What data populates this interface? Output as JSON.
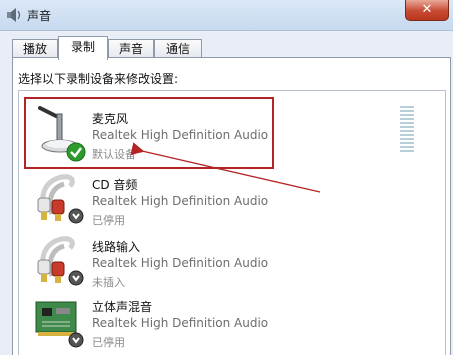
{
  "window": {
    "title": "声音"
  },
  "tabs": [
    {
      "label": "播放",
      "active": false
    },
    {
      "label": "录制",
      "active": true
    },
    {
      "label": "声音",
      "active": false
    },
    {
      "label": "通信",
      "active": false
    }
  ],
  "instruction": "选择以下录制设备来修改设置:",
  "devices": [
    {
      "name": "麦克风",
      "driver": "Realtek High Definition Audio",
      "status": "默认设备",
      "icon": "microphone-icon",
      "state_badge": "default-check-icon"
    },
    {
      "name": "CD 音频",
      "driver": "Realtek High Definition Audio",
      "status": "已停用",
      "icon": "cd-audio-cable-icon",
      "state_badge": "disabled-arrow-icon"
    },
    {
      "name": "线路输入",
      "driver": "Realtek High Definition Audio",
      "status": "未插入",
      "icon": "line-in-cable-icon",
      "state_badge": "unplugged-arrow-icon"
    },
    {
      "name": "立体声混音",
      "driver": "Realtek High Definition Audio",
      "status": "已停用",
      "icon": "sound-card-icon",
      "state_badge": "disabled-arrow-icon"
    }
  ],
  "colors": {
    "highlight": "#b52424",
    "default_check": "#2e9a2e",
    "titlebar": "#c6d9ef"
  }
}
